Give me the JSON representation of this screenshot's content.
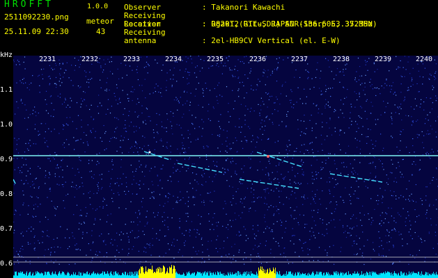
{
  "header": {
    "app_title": "HROFFT",
    "version": "1.0.0",
    "file_name": "2511092230.png",
    "datetime": "25.11.09 22:30",
    "meteor_label": "meteor",
    "meteor_count": "43"
  },
  "info": [
    {
      "key": "Observer",
      "value": ": Takanori Kawachi"
    },
    {
      "key": "Receiving Location",
      "value": ": Ogaki, Gifu, JAPAN (136.60E, 35.35N)"
    },
    {
      "key": "Receiver",
      "value": ": R820T2(RTL-SDR) SDR-Sharp 53.372MHz"
    },
    {
      "key": "Receiving antenna",
      "value": ": 2el-HB9CV Vertical (el. E-W)"
    }
  ],
  "chart_data": {
    "type": "heatmap",
    "ylabel": "kHz",
    "x_ticks": [
      "2231",
      "2232",
      "2233",
      "2234",
      "2235",
      "2236",
      "2237",
      "2238",
      "2239",
      "2240"
    ],
    "y_ticks": [
      "1.1",
      "1.0",
      "0.9",
      "0.8",
      "0.7",
      "0.6"
    ],
    "colors": {
      "background": "#05053f",
      "signal": "#00ffff",
      "strong": "#ffff00"
    }
  }
}
